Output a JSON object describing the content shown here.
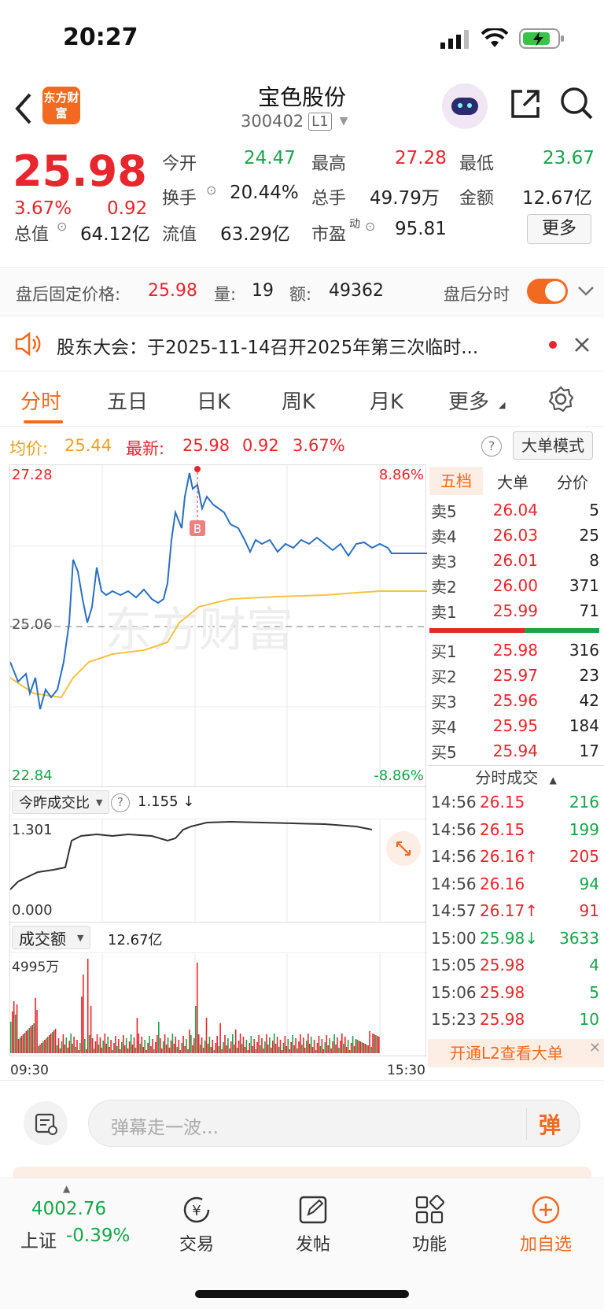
{
  "status": {
    "time": "20:27"
  },
  "header": {
    "logo": "东方财富",
    "name": "宝色股份",
    "code": "300402",
    "level": "L1"
  },
  "quote": {
    "price": "25.98",
    "pct": "3.67%",
    "change": "0.92",
    "labels": {
      "open": "今开",
      "high": "最高",
      "low": "最低",
      "turnover": "换手",
      "vol": "总手",
      "amount": "金额",
      "mcap": "总值",
      "float": "流值",
      "pe": "市盈",
      "pe_sup": "动",
      "more": "更多"
    },
    "open": "24.47",
    "high": "27.28",
    "low": "23.67",
    "turnover": "20.44%",
    "vol": "49.79万",
    "amount": "12.67亿",
    "mcap": "64.12亿",
    "float": "63.29亿",
    "pe": "95.81"
  },
  "after": {
    "price_label": "盘后固定价格:",
    "price": "25.98",
    "vol_label": "量:",
    "vol": "19",
    "amt_label": "额:",
    "amt": "49362",
    "toggle_label": "盘后分时"
  },
  "notice": {
    "text": "股东大会：于2025-11-14召开2025年第三次临时..."
  },
  "tabs": [
    "分时",
    "五日",
    "日K",
    "周K",
    "月K",
    "更多"
  ],
  "avg": {
    "avg_label": "均价:",
    "avg": "25.44",
    "latest_label": "最新:",
    "latest": "25.98",
    "chg": "0.92",
    "pct": "3.67%",
    "mode": "大单模式"
  },
  "chart": {
    "ymax": "27.28",
    "ymin": "22.84",
    "pmax": "8.86%",
    "pmin": "-8.86%",
    "prev": "25.06",
    "marker": "B",
    "watermark": "东方财富"
  },
  "ratio": {
    "label": "今昨成交比",
    "value": "1.155 ↓",
    "ymax": "1.301",
    "ymin": "0.000"
  },
  "amount": {
    "label": "成交额",
    "value": "12.67亿",
    "ymax": "4995万",
    "t_start": "09:30",
    "t_end": "15:30"
  },
  "side": {
    "tabs": [
      "五档",
      "大单",
      "分价"
    ],
    "asks": [
      {
        "l": "卖5",
        "p": "26.04",
        "v": "5"
      },
      {
        "l": "卖4",
        "p": "26.03",
        "v": "25"
      },
      {
        "l": "卖3",
        "p": "26.01",
        "v": "8"
      },
      {
        "l": "卖2",
        "p": "26.00",
        "v": "371"
      },
      {
        "l": "卖1",
        "p": "25.99",
        "v": "71"
      }
    ],
    "bids": [
      {
        "l": "买1",
        "p": "25.98",
        "v": "316"
      },
      {
        "l": "买2",
        "p": "25.97",
        "v": "23"
      },
      {
        "l": "买3",
        "p": "25.96",
        "v": "42"
      },
      {
        "l": "买4",
        "p": "25.95",
        "v": "184"
      },
      {
        "l": "买5",
        "p": "25.94",
        "v": "17"
      }
    ],
    "trades_title": "分时成交",
    "trades": [
      {
        "t": "14:56",
        "p": "26.15",
        "v": "216"
      },
      {
        "t": "14:56",
        "p": "26.15",
        "v": "199"
      },
      {
        "t": "14:56",
        "p": "26.16↑",
        "v": "205"
      },
      {
        "t": "14:56",
        "p": "26.16",
        "v": "94"
      },
      {
        "t": "14:57",
        "p": "26.17↑",
        "v": "91"
      },
      {
        "t": "15:00",
        "p": "25.98↓",
        "v": "3633"
      },
      {
        "t": "15:05",
        "p": "25.98",
        "v": "4"
      },
      {
        "t": "15:06",
        "p": "25.98",
        "v": "5"
      },
      {
        "t": "15:23",
        "p": "25.98",
        "v": "10"
      }
    ],
    "l2": "开通L2查看大单"
  },
  "comment": {
    "placeholder": "弹幕走一波...",
    "send": "弹"
  },
  "bottom": {
    "index_value": "4002.76",
    "index_name": "上证",
    "index_pct": "-0.39%",
    "trade": "交易",
    "post": "发帖",
    "func": "功能",
    "add": "加自选"
  }
}
